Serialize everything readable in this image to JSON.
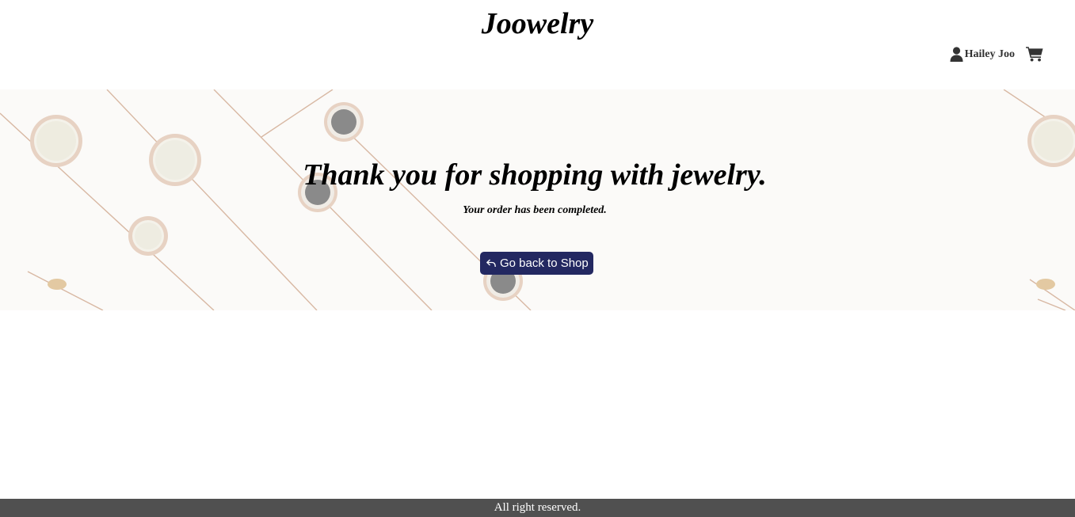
{
  "header": {
    "brand": "Joowelry",
    "user_name": "Hailey Joo",
    "user_icon": "user-icon",
    "cart_icon": "shopping-cart-icon"
  },
  "hero": {
    "title": "Thank you for shopping with jewelry.",
    "subtitle": "Your order has been completed.",
    "back_button_label": "Go back to Shop",
    "back_button_icon": "reply-arrow-icon",
    "background": "jewelry-bracelets-image"
  },
  "footer": {
    "text": "All right reserved."
  },
  "colors": {
    "button_bg": "#232861",
    "footer_bg": "#505050",
    "text": "#000000",
    "hero_bg": "#fbfaf8"
  }
}
